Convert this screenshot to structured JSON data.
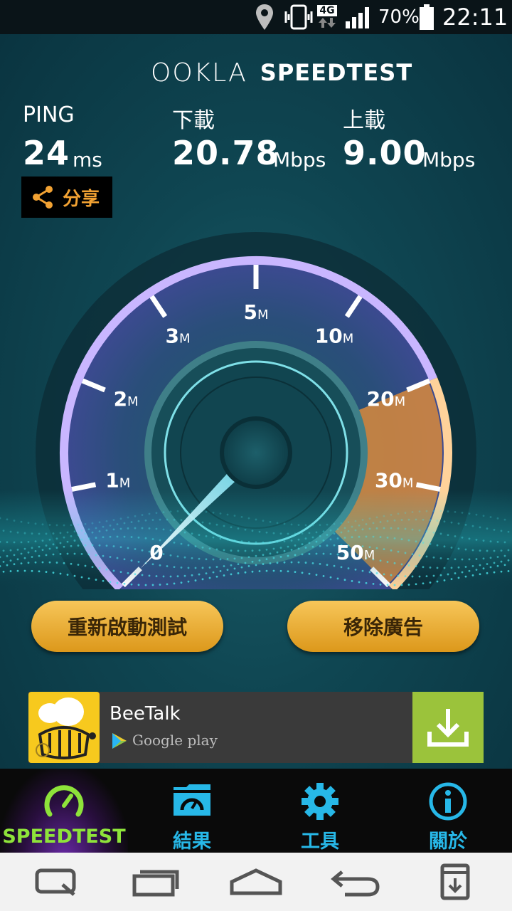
{
  "status_bar": {
    "network": "4G",
    "battery": "70%",
    "time": "22:11",
    "icons": [
      "location-icon",
      "vibrate-icon",
      "data-arrows-icon",
      "signal-icon",
      "battery-icon"
    ]
  },
  "header": {
    "brand": "OOKLA",
    "product": "SPEEDTEST"
  },
  "metrics": {
    "ping": {
      "label": "PING",
      "value": "24",
      "unit": "ms"
    },
    "download": {
      "label": "下載",
      "value": "20.78",
      "unit": "Mbps"
    },
    "upload": {
      "label": "上載",
      "value": "9.00",
      "unit": "Mbps"
    }
  },
  "share": {
    "label": "分享"
  },
  "gauge": {
    "ticks": [
      {
        "num": "0",
        "suffix": ""
      },
      {
        "num": "1",
        "suffix": "M"
      },
      {
        "num": "2",
        "suffix": "M"
      },
      {
        "num": "3",
        "suffix": "M"
      },
      {
        "num": "5",
        "suffix": "M"
      },
      {
        "num": "10",
        "suffix": "M"
      },
      {
        "num": "20",
        "suffix": "M"
      },
      {
        "num": "30",
        "suffix": "M"
      },
      {
        "num": "50",
        "suffix": "M"
      }
    ],
    "needle_value_mbps": 0
  },
  "buttons": {
    "restart": "重新啟動測試",
    "remove_ads": "移除廣告"
  },
  "ad": {
    "title": "BeeTalk",
    "store": "Google play",
    "accent": "#9bc33b"
  },
  "tabs": [
    {
      "label": "SPEEDTEST",
      "icon": "speedometer-icon",
      "color": "#8ee33a"
    },
    {
      "label": "結果",
      "icon": "results-folder-icon",
      "color": "#27b8e8"
    },
    {
      "label": "工具",
      "icon": "gear-icon",
      "color": "#27b8e8"
    },
    {
      "label": "關於",
      "icon": "info-icon",
      "color": "#27b8e8"
    }
  ],
  "nav": [
    "quick-memo-icon",
    "recent-apps-icon",
    "home-icon",
    "back-icon",
    "download-icon"
  ],
  "colors": {
    "accent_orange": "#f2a233",
    "gauge_purple": "#8a5fd6",
    "button_gold": "#e8ad33"
  }
}
